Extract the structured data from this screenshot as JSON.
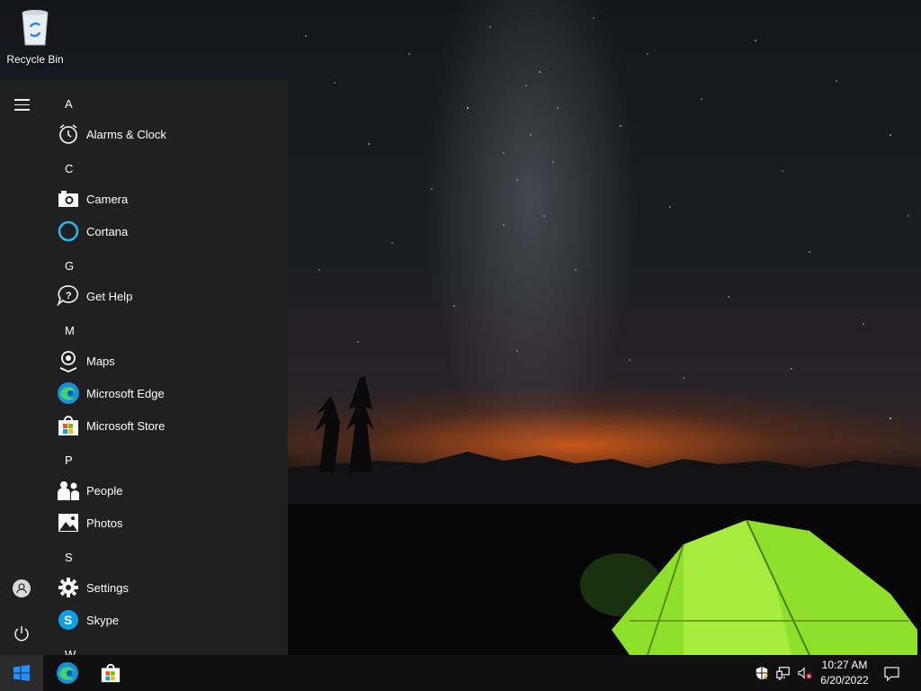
{
  "desktop": {
    "recycle_bin_label": "Recycle Bin"
  },
  "start_menu": {
    "letters": {
      "a": "A",
      "c": "C",
      "g": "G",
      "m": "M",
      "p": "P",
      "s": "S",
      "w": "W"
    },
    "apps": {
      "alarms": "Alarms & Clock",
      "camera": "Camera",
      "cortana": "Cortana",
      "get_help": "Get Help",
      "maps": "Maps",
      "edge": "Microsoft Edge",
      "store": "Microsoft Store",
      "people": "People",
      "photos": "Photos",
      "settings": "Settings",
      "skype": "Skype"
    }
  },
  "taskbar": {
    "pinned": [
      "edge-icon",
      "store-icon"
    ],
    "tray_icons": [
      "security-warning-icon",
      "network-icon",
      "volume-muted-icon",
      "action-center-icon"
    ],
    "clock": {
      "time": "10:27 AM",
      "date": "6/20/2022"
    }
  },
  "colors": {
    "start_bg": "#202020",
    "taskbar_bg": "#101010",
    "accent_blue": "#1e90ff",
    "tent_green": "#8ee02a"
  }
}
